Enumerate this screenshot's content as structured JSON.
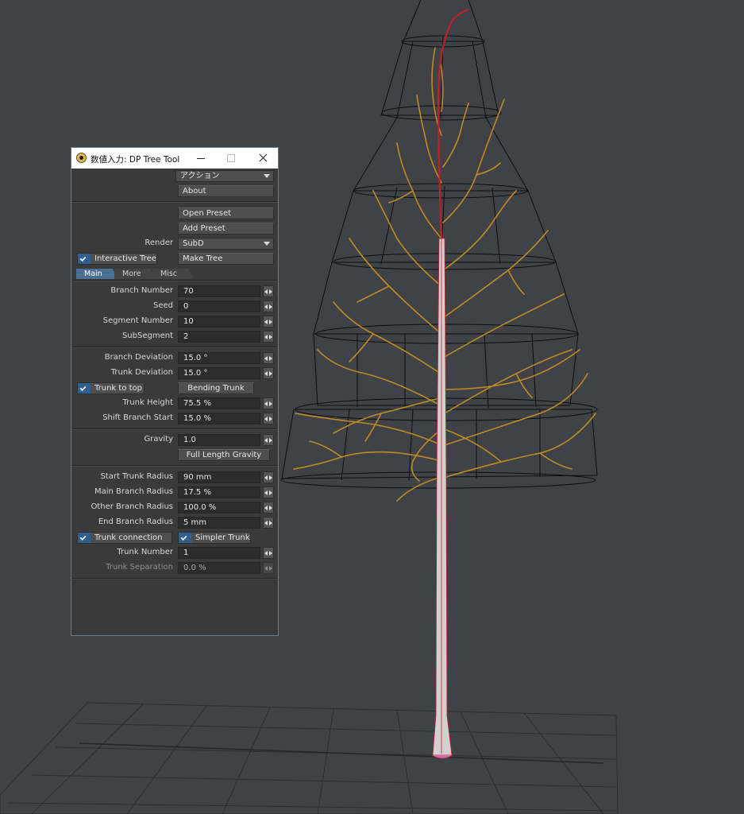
{
  "window": {
    "title": "数値入力: DP Tree Tool"
  },
  "actions": {
    "action_dropdown": "アクション",
    "about": "About"
  },
  "preset": {
    "open": "Open Preset",
    "add": "Add Preset",
    "render_label": "Render",
    "render_value": "SubD",
    "interactive_tree": "Interactive Tree",
    "make_tree": "Make Tree"
  },
  "tabs": [
    {
      "label": "Main"
    },
    {
      "label": "More"
    },
    {
      "label": "Misc"
    }
  ],
  "main": {
    "branch_number": {
      "label": "Branch Number",
      "value": "70"
    },
    "seed": {
      "label": "Seed",
      "value": "0"
    },
    "segment_number": {
      "label": "Segment Number",
      "value": "10"
    },
    "subsegment": {
      "label": "SubSegment",
      "value": "2"
    },
    "branch_deviation": {
      "label": "Branch Deviation",
      "value": "15.0 °"
    },
    "trunk_deviation": {
      "label": "Trunk Deviation",
      "value": "15.0 °"
    },
    "trunk_to_top": "Trunk to top",
    "bending_trunk": "Bending Trunk",
    "trunk_height": {
      "label": "Trunk Height",
      "value": "75.5 %"
    },
    "shift_branch_start": {
      "label": "Shift Branch Start",
      "value": "15.0 %"
    },
    "gravity": {
      "label": "Gravity",
      "value": "1.0"
    },
    "full_length_gravity": "Full Length Gravity",
    "start_trunk_radius": {
      "label": "Start Trunk Radius",
      "value": "90 mm"
    },
    "main_branch_radius": {
      "label": "Main Branch Radius",
      "value": "17.5 %"
    },
    "other_branch_radius": {
      "label": "Other Branch Radius",
      "value": "100.0 %"
    },
    "end_branch_radius": {
      "label": "End Branch Radius",
      "value": "5 mm"
    },
    "trunk_connection": "Trunk connection",
    "simpler_trunk": "Simpler Trunk",
    "trunk_number": {
      "label": "Trunk Number",
      "value": "1"
    },
    "trunk_separation": {
      "label": "Trunk Separation",
      "value": "0.0 %"
    }
  },
  "colors": {
    "background": "#3f4347",
    "branch": "#c08a22",
    "trunk_edge": "#c0202a",
    "wireframe": "#0e0e0e",
    "accent": "#4a6f93"
  }
}
